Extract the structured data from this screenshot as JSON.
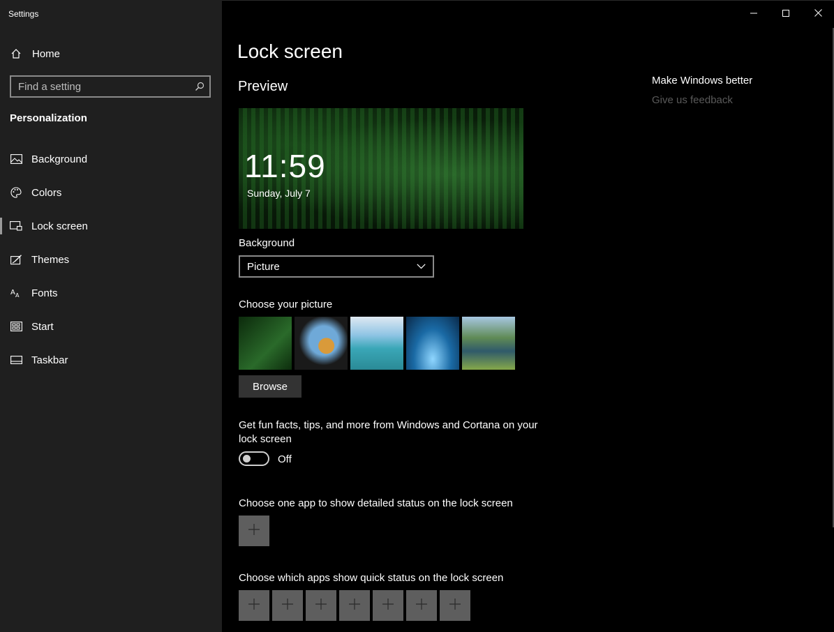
{
  "window": {
    "title": "Settings"
  },
  "sidebar": {
    "home_label": "Home",
    "search_placeholder": "Find a setting",
    "section_title": "Personalization",
    "items": [
      {
        "label": "Background",
        "icon": "picture-icon"
      },
      {
        "label": "Colors",
        "icon": "palette-icon"
      },
      {
        "label": "Lock screen",
        "icon": "lock-screen-icon",
        "active": true
      },
      {
        "label": "Themes",
        "icon": "themes-icon"
      },
      {
        "label": "Fonts",
        "icon": "fonts-icon"
      },
      {
        "label": "Start",
        "icon": "start-icon"
      },
      {
        "label": "Taskbar",
        "icon": "taskbar-icon"
      }
    ]
  },
  "main": {
    "page_title": "Lock screen",
    "preview_title": "Preview",
    "preview_time": "11:59",
    "preview_date": "Sunday, July 7",
    "background_label": "Background",
    "background_value": "Picture",
    "choose_picture_label": "Choose your picture",
    "browse_label": "Browse",
    "funfacts_label": "Get fun facts, tips, and more from Windows and Cortana on your lock screen",
    "funfacts_state": "Off",
    "detailed_status_label": "Choose one app to show detailed status on the lock screen",
    "quick_status_label": "Choose which apps show quick status on the lock screen"
  },
  "aside": {
    "heading": "Make Windows better",
    "feedback_link": "Give us feedback"
  },
  "colors": {
    "sidebar_bg": "#1f1f1f",
    "main_bg": "#000000",
    "add_tile": "#5e5e5e",
    "muted_link": "#5a5a5a"
  }
}
